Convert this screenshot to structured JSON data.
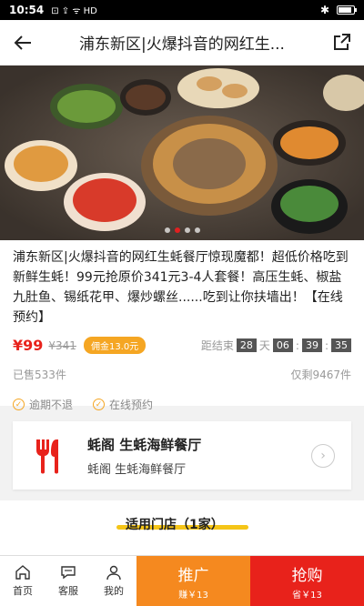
{
  "statusbar": {
    "time": "10:54",
    "indicators": "⊡ ⇪ ᯤ HD",
    "bt": "✱",
    "battery_level": 0.8
  },
  "navbar": {
    "title": "浦东新区|火爆抖音的网红生..."
  },
  "hero": {
    "slide_count": 4,
    "active_slide": 1
  },
  "deal": {
    "description": "浦东新区|火爆抖音的网红生蚝餐厅惊现魔都！超低价格吃到新鲜生蚝！99元抢原价341元3-4人套餐！高压生蚝、椒盐九肚鱼、锡纸花甲、爆炒螺丝......吃到让你扶墙出！【在线预约】",
    "price": "¥99",
    "old_price": "¥341",
    "commission": "佣金13.0元",
    "countdown_label": "距结束",
    "days": "28",
    "days_unit": "天",
    "hours": "06",
    "minutes": "39",
    "seconds": "35",
    "sold": "已售533件",
    "remaining": "仅剩9467件",
    "tag1": "逾期不退",
    "tag2": "在线预约"
  },
  "store": {
    "name": "蚝阁 生蚝海鲜餐厅",
    "sub": "蚝阁 生蚝海鲜餐厅"
  },
  "section": {
    "title": "适用门店（1家）"
  },
  "bottombar": {
    "home": "首页",
    "service": "客服",
    "mine": "我的",
    "promote": "推广",
    "promote_sub": "赚￥13",
    "buy": "抢购",
    "buy_sub": "省￥13"
  },
  "colors": {
    "accent": "#e8221b",
    "orange": "#f5891f",
    "yellow": "#f5c518"
  }
}
